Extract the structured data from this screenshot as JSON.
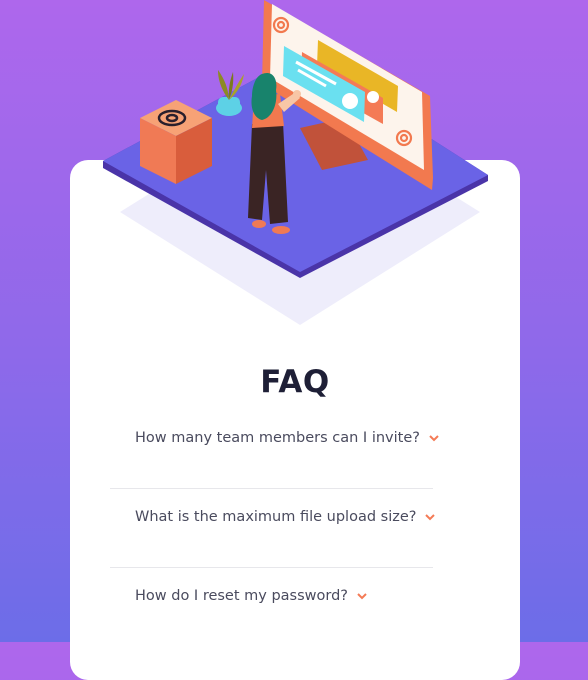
{
  "faq": {
    "title": "FAQ",
    "questions": [
      "How many team members can I invite?",
      "What is the maximum file upload size?",
      "How do I reset my password?"
    ]
  },
  "colors": {
    "background_top": "#ae67ec",
    "background_bottom": "#6c6de8",
    "card": "#ffffff",
    "title": "#1e1f36",
    "question_text": "#4a4b5e",
    "chevron": "#f47b56",
    "divider": "#e7e7eb",
    "platform": "#6a63e6",
    "monitor_frame": "#f2794f",
    "box": "#f07a55"
  },
  "icons": {
    "chevron": "chevron-down-icon",
    "at_symbol": "at-sign-icon"
  }
}
